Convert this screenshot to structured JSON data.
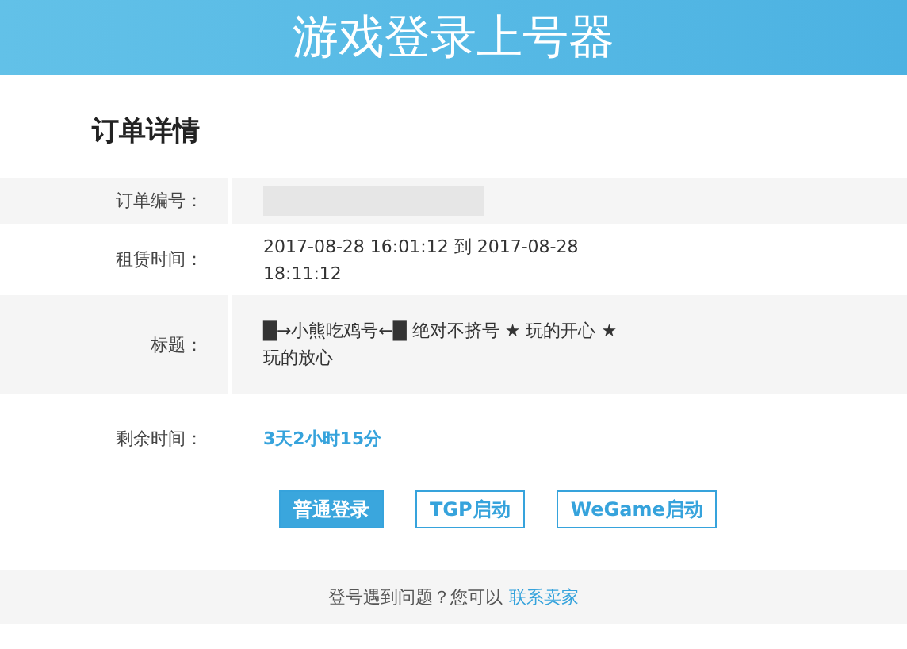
{
  "header": {
    "title": "游戏登录上号器"
  },
  "section_title": "订单详情",
  "fields": [
    {
      "kind": "redacted",
      "label": "订单编号："
    },
    {
      "kind": "text",
      "label": "租赁时间：",
      "value": "2017-08-28 16:01:12 到 2017-08-28 18:11:12"
    },
    {
      "kind": "text",
      "label": "标题：",
      "value": "█→小熊吃鸡号←█ 绝对不挤号 ★ 玩的开心 ★ 玩的放心"
    },
    {
      "kind": "highlight",
      "label": "剩余时间：",
      "value": "3天2小时15分"
    }
  ],
  "buttons": [
    {
      "label": "普通登录",
      "selected": true
    },
    {
      "label": "TGP启动",
      "selected": false
    },
    {
      "label": "WeGame启动",
      "selected": false
    }
  ],
  "footer": {
    "text": "登号遇到问题？您可以",
    "link": "联系卖家"
  }
}
